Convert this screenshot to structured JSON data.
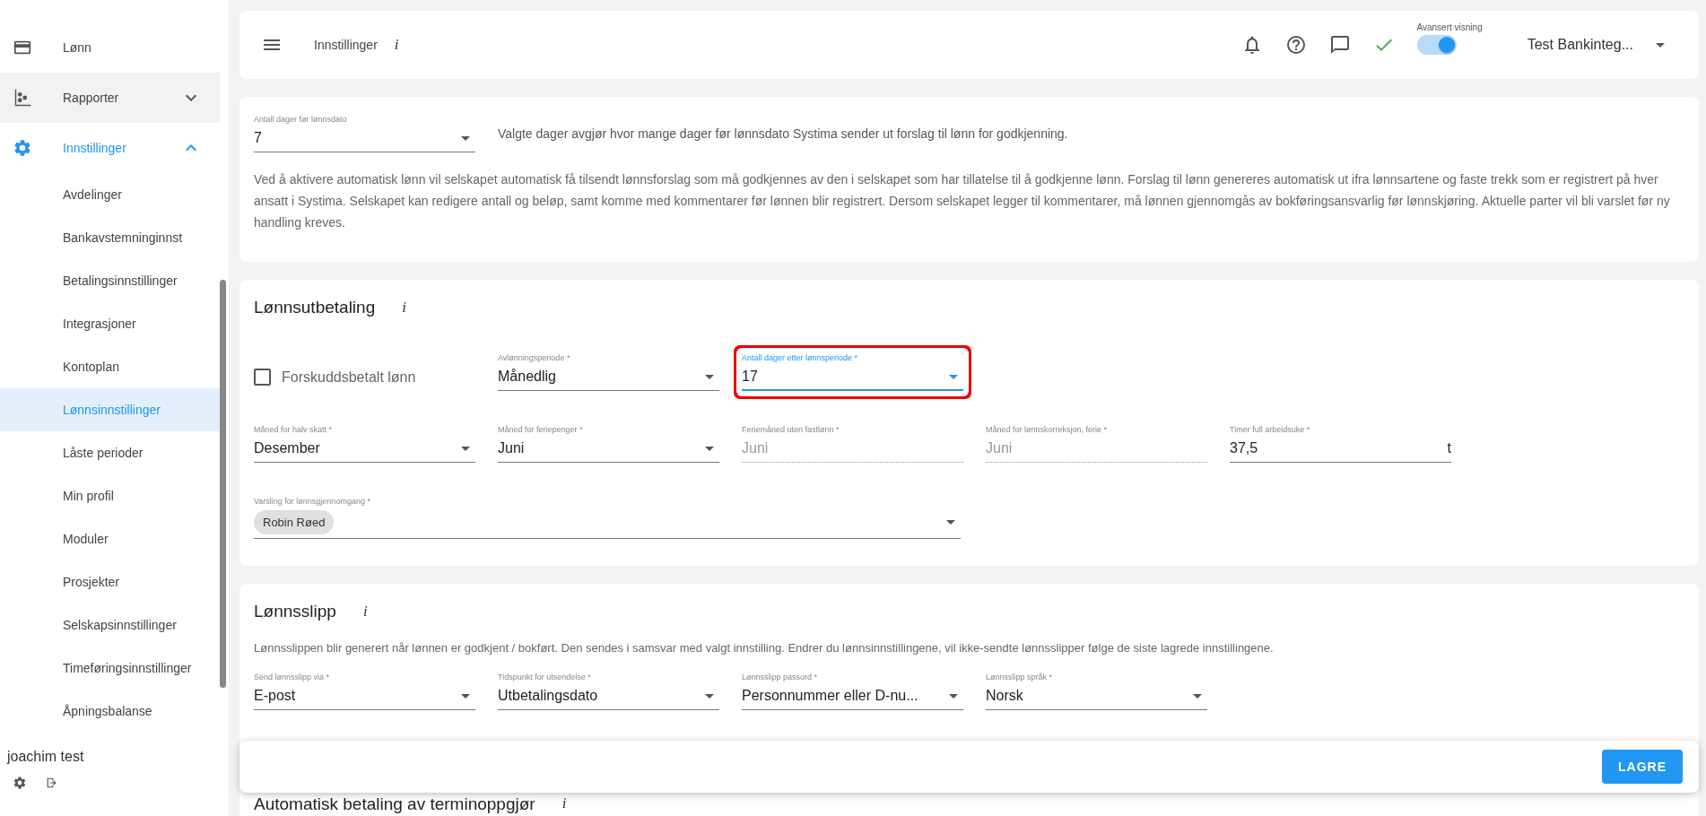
{
  "sidebar": {
    "items": [
      {
        "label": "Lønn",
        "hovered": false,
        "selected": false
      },
      {
        "label": "Rapporter",
        "hovered": true,
        "selected": false,
        "expanded": false
      },
      {
        "label": "Innstillinger",
        "hovered": false,
        "selected": true,
        "expanded": true,
        "children": [
          {
            "label": "Avdelinger",
            "selected": false
          },
          {
            "label": "Bankavstemninginnst",
            "selected": false
          },
          {
            "label": "Betalingsinnstillinger",
            "selected": false
          },
          {
            "label": "Integrasjoner",
            "selected": false
          },
          {
            "label": "Kontoplan",
            "selected": false
          },
          {
            "label": "Lønnsinnstillinger",
            "selected": true
          },
          {
            "label": "Låste perioder",
            "selected": false
          },
          {
            "label": "Min profil",
            "selected": false
          },
          {
            "label": "Moduler",
            "selected": false
          },
          {
            "label": "Prosjekter",
            "selected": false
          },
          {
            "label": "Selskapsinnstillinger",
            "selected": false
          },
          {
            "label": "Timeføringsinnstillinger",
            "selected": false
          },
          {
            "label": "Åpningsbalanse",
            "selected": false
          }
        ]
      }
    ],
    "user": "joachim test"
  },
  "top_bar": {
    "title": "Innstillinger",
    "info": "i",
    "toggle": {
      "label": "Avansert visning",
      "on": true
    },
    "company": "Test Bankinteg..."
  },
  "automatic_pay": {
    "field": {
      "kind": "select",
      "label": "Antall dager før lønnsdato",
      "value": "7",
      "disabled": false,
      "focused": false,
      "highlighted": false
    },
    "field_hint": "Valgte dager avgjør hvor mange dager før lønnsdato Systima sender ut forslag til lønn for godkjenning.",
    "description": "Ved å aktivere automatisk lønn vil selskapet automatisk få tilsendt lønnsforslag som må godkjennes av den i selskapet som har tillatelse til å godkjenne lønn. Forslag til lønn genereres automatisk ut ifra lønnsartene og faste trekk som er registrert på hver ansatt i Systima. Selskapet kan redigere antall og beløp, samt komme med kommentarer før lønnen blir registrert. Dersom selskapet legger til kommentarer, må lønnen gjennomgås av bokføringsansvarlig før lønnskjøring. Aktuelle parter vil bli varslet før ny handling kreves."
  },
  "salary_payment": {
    "title": "Lønnsutbetaling",
    "info": "i",
    "checkbox": {
      "label": "Forskuddsbetalt lønn",
      "checked": false
    },
    "row_1": [
      {
        "kind": "select",
        "label": "Avlønningsperiode *",
        "value": "Månedlig",
        "disabled": false,
        "focused": false,
        "highlighted": false
      },
      {
        "kind": "select",
        "label": "Antall dager etter lønnsperiode *",
        "value": "17",
        "disabled": false,
        "focused": true,
        "highlighted": true
      }
    ],
    "row_2": [
      {
        "kind": "select",
        "label": "Måned for halv skatt *",
        "value": "Desember",
        "disabled": false,
        "focused": false,
        "highlighted": false
      },
      {
        "kind": "select",
        "label": "Måned for feriepenger *",
        "value": "Juni",
        "disabled": false,
        "focused": false,
        "highlighted": false
      },
      {
        "kind": "text",
        "label": "Feriemåned uten fastlønn *",
        "value": "Juni",
        "disabled": true,
        "focused": false,
        "highlighted": false
      },
      {
        "kind": "text",
        "label": "Måned for lønnskorreksjon, ferie *",
        "value": "Juni",
        "disabled": true,
        "focused": false,
        "highlighted": false
      },
      {
        "kind": "text",
        "label": "Timer full arbeidsuke *",
        "value": "37,5",
        "suffix": "t",
        "disabled": false,
        "focused": false,
        "highlighted": false
      }
    ],
    "row_3": [
      {
        "kind": "chips",
        "label": "Varsling for lønnsgjennomgang *",
        "chips": [
          "Robin Røed"
        ],
        "disabled": false,
        "focused": false,
        "highlighted": false
      }
    ]
  },
  "payslip": {
    "title": "Lønnsslipp",
    "info": "i",
    "description": "Lønnsslippen blir generert når lønnen er godkjent / bokført. Den sendes i samsvar med valgt innstilling. Endrer du lønnsinnstillingene, vil ikke-sendte lønnsslipper følge de siste lagrede innstillingene.",
    "fields": [
      {
        "kind": "select",
        "label": "Send lønnsslipp via *",
        "value": "E-post",
        "disabled": false,
        "focused": false,
        "highlighted": false
      },
      {
        "kind": "select",
        "label": "Tidspunkt for utsendelse *",
        "value": "Utbetalingsdato",
        "disabled": false,
        "focused": false,
        "highlighted": false
      },
      {
        "kind": "select",
        "label": "Lønnsslipp passord *",
        "value": "Personnummer eller D-nu...",
        "disabled": false,
        "focused": false,
        "highlighted": false
      },
      {
        "kind": "select",
        "label": "Lønnsslipp språk *",
        "value": "Norsk",
        "disabled": false,
        "focused": false,
        "highlighted": false
      }
    ]
  },
  "next_section": {
    "title": "Automatisk betaling av terminoppgjør",
    "info": "i"
  },
  "save_bar": {
    "button": "LAGRE"
  }
}
